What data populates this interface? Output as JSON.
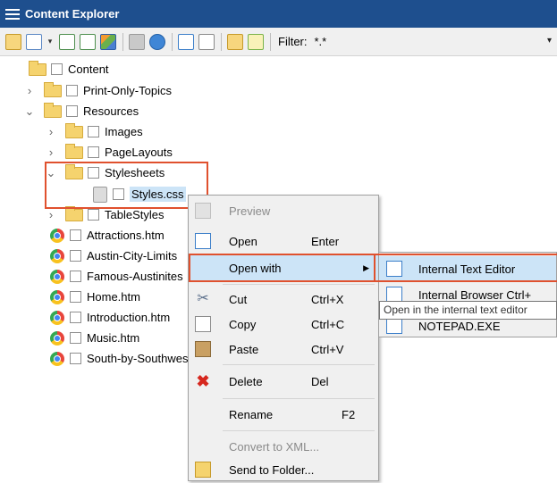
{
  "window": {
    "title": "Content Explorer"
  },
  "toolbar": {
    "filter_label": "Filter:",
    "filter_value": "*.*"
  },
  "tree": {
    "root": "Content",
    "items": [
      {
        "label": "Print-Only-Topics"
      },
      {
        "label": "Resources"
      },
      {
        "label": "Images"
      },
      {
        "label": "PageLayouts"
      },
      {
        "label": "Stylesheets"
      },
      {
        "label": "Styles.css"
      },
      {
        "label": "TableStyles"
      },
      {
        "label": "Attractions.htm"
      },
      {
        "label": "Austin-City-Limits"
      },
      {
        "label": "Famous-Austinites"
      },
      {
        "label": "Home.htm"
      },
      {
        "label": "Introduction.htm"
      },
      {
        "label": "Music.htm"
      },
      {
        "label": "South-by-Southwest"
      }
    ]
  },
  "context_menu": {
    "preview": "Preview",
    "open": "Open",
    "open_shortcut": "Enter",
    "open_with": "Open with",
    "cut": "Cut",
    "cut_shortcut": "Ctrl+X",
    "copy": "Copy",
    "copy_shortcut": "Ctrl+C",
    "paste": "Paste",
    "paste_shortcut": "Ctrl+V",
    "delete": "Delete",
    "delete_shortcut": "Del",
    "rename": "Rename",
    "rename_shortcut": "F2",
    "convert": "Convert to XML...",
    "send": "Send to Folder..."
  },
  "submenu": {
    "items": [
      "Internal Text Editor",
      "Internal Browser   Ctrl+",
      "NOTEPAD.EXE"
    ]
  },
  "tooltip": "Open in the internal text editor"
}
